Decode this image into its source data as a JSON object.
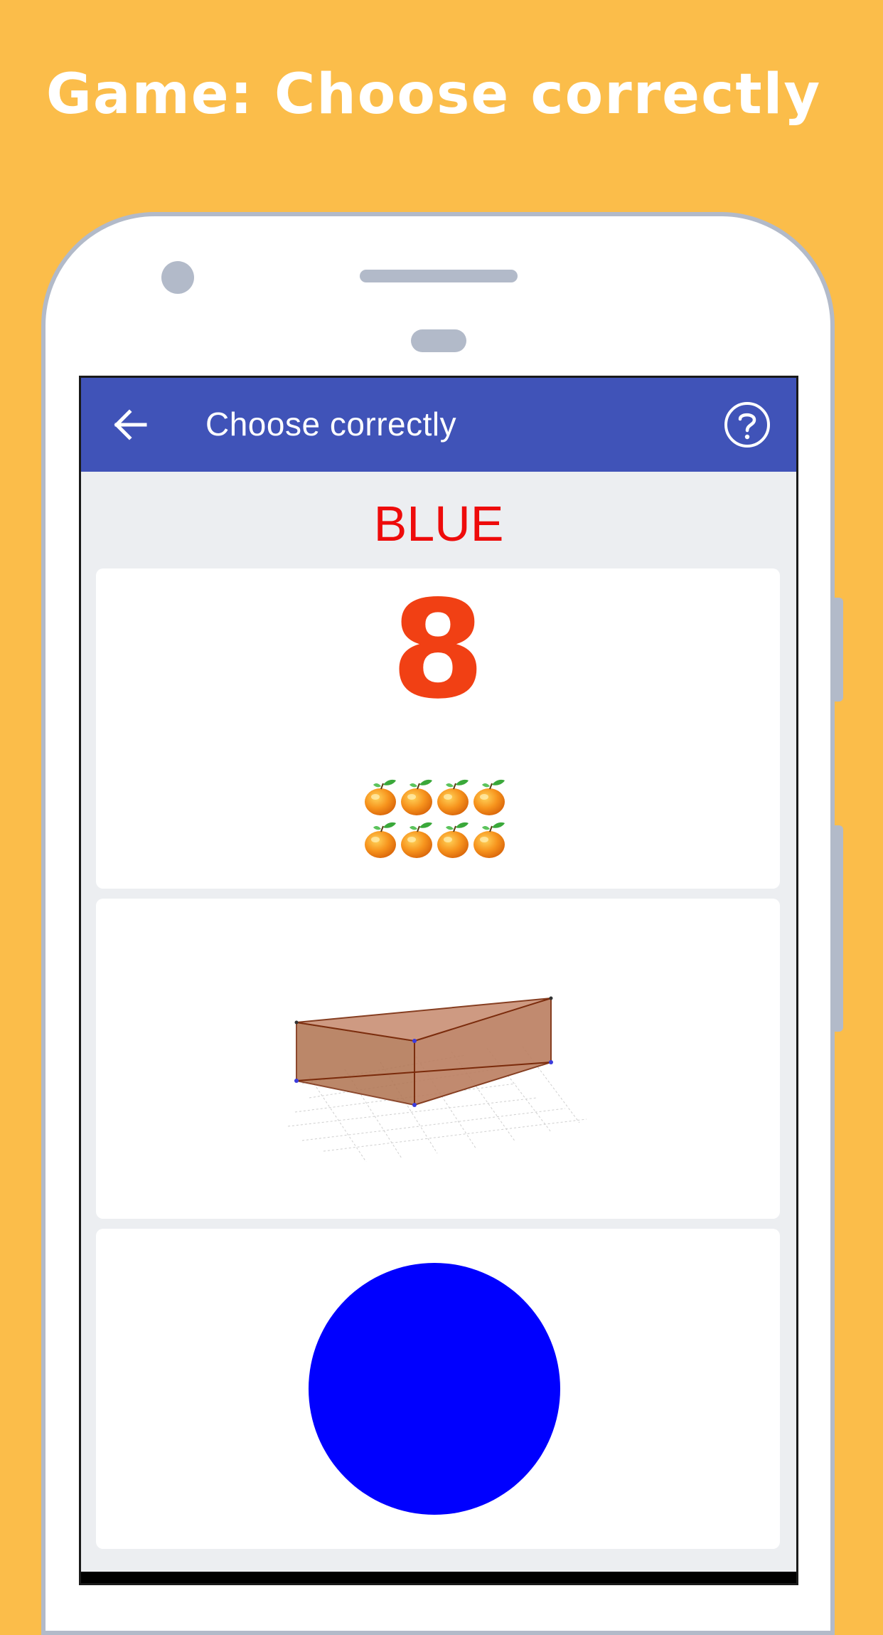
{
  "promo": {
    "headline": "Game: Choose correctly"
  },
  "appbar": {
    "title": "Choose correctly"
  },
  "prompt": {
    "word": "BLUE"
  },
  "cards": [
    {
      "digit": "8",
      "fruit_count": 8
    },
    {
      "shape": "triangular-prism"
    },
    {
      "shape": "circle",
      "color": "#0000ff"
    }
  ],
  "colors": {
    "background": "#fbbd4a",
    "appbar": "#4053b8",
    "prompt": "#ee0b0b",
    "digit": "#f14014",
    "circle": "#0000ff"
  },
  "icons": {
    "back": "arrow-left-icon",
    "help": "question-circle-icon"
  }
}
